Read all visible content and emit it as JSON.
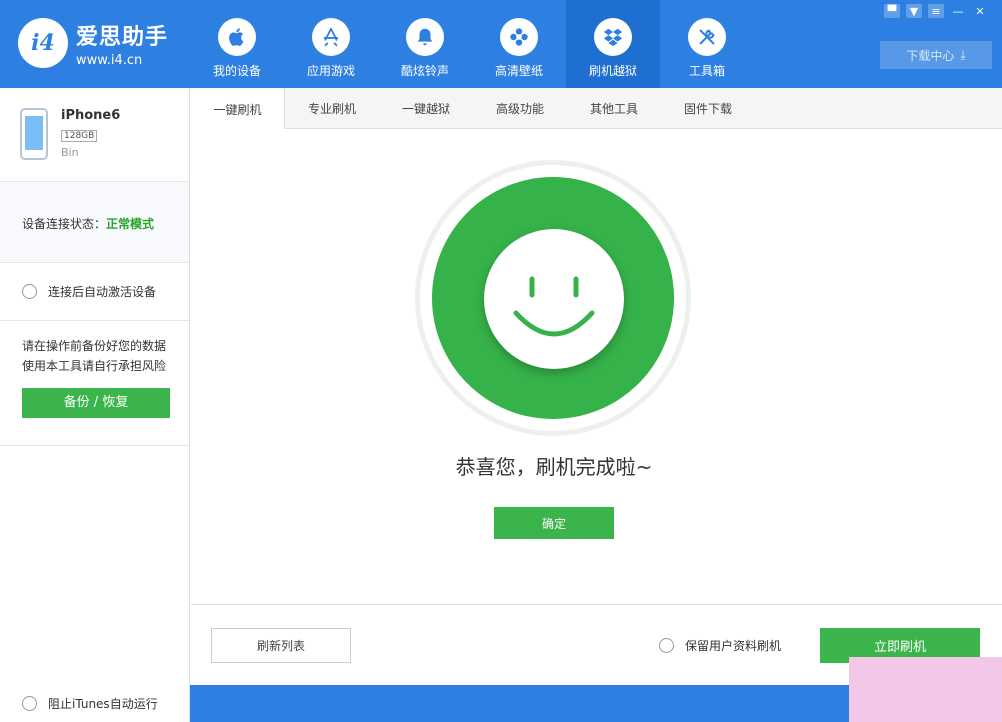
{
  "app": {
    "name": "爱思助手",
    "url": "www.i4.cn",
    "logo_mark": "i4"
  },
  "nav": [
    {
      "label": "我的设备",
      "icon": "apple-icon"
    },
    {
      "label": "应用游戏",
      "icon": "app-store-icon"
    },
    {
      "label": "酷炫铃声",
      "icon": "bell-icon"
    },
    {
      "label": "高清壁纸",
      "icon": "flower-icon"
    },
    {
      "label": "刷机越狱",
      "icon": "dropbox-icon"
    },
    {
      "label": "工具箱",
      "icon": "tools-icon"
    }
  ],
  "window_controls": [
    "message-icon",
    "shirt-icon",
    "menu-icon",
    "minimize-icon",
    "close-icon"
  ],
  "download_center": "下载中心",
  "device": {
    "name": "iPhone6",
    "capacity": "128GB",
    "user": "Bin"
  },
  "status": {
    "label": "设备连接状态：",
    "value": "正常模式"
  },
  "auto_activate_label": "连接后自动激活设备",
  "warning": {
    "line1": "请在操作前备份好您的数据",
    "line2": "使用本工具请自行承担风险"
  },
  "backup_button": "备份 / 恢复",
  "tabs": [
    "一键刷机",
    "专业刷机",
    "一键越狱",
    "高级功能",
    "其他工具",
    "固件下载"
  ],
  "main": {
    "message": "恭喜您，刷机完成啦~",
    "confirm": "确定"
  },
  "bottom": {
    "refresh": "刷新列表",
    "keep_data": "保留用户资料刷机",
    "flash_now": "立即刷机"
  },
  "statusbar": {
    "block_itunes": "阻止iTunes自动运行"
  },
  "colors": {
    "header_blue": "#2d7fe2",
    "accent_green": "#3cb44c",
    "status_ok_green": "#2aa52a"
  }
}
